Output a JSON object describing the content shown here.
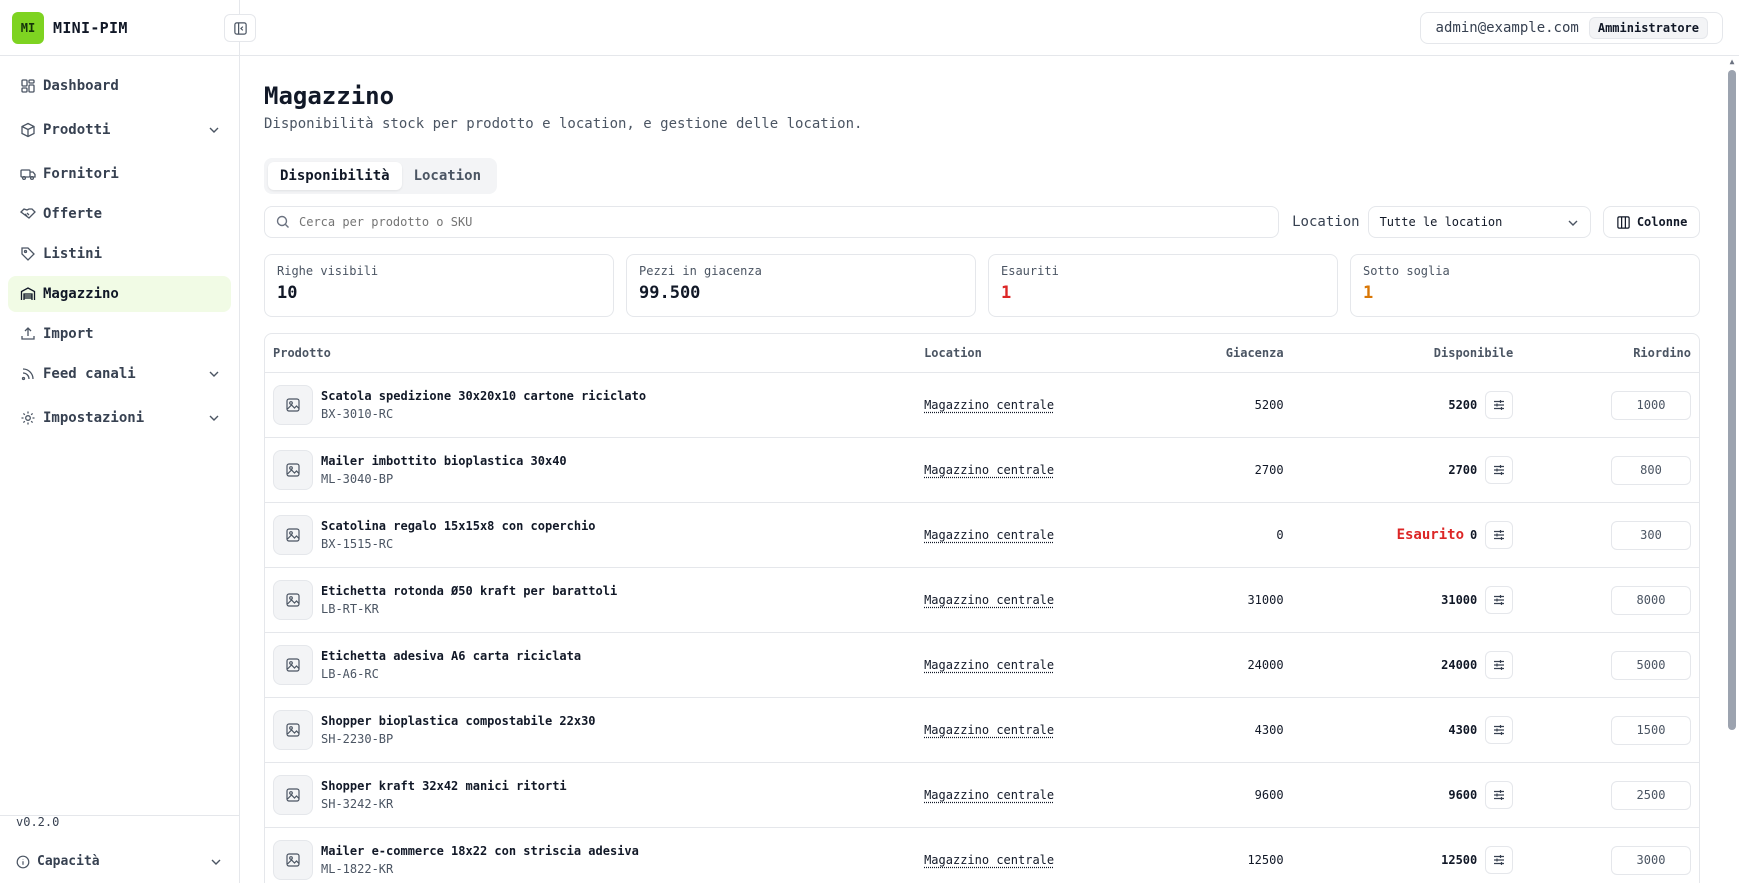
{
  "app": {
    "logo_text": "MI",
    "name": "MINI-PIM",
    "version": "v0.2.0",
    "accent": "#7ed321"
  },
  "sidebar": {
    "items": [
      {
        "label": "Dashboard",
        "icon": "dashboard-icon"
      },
      {
        "label": "Prodotti",
        "icon": "package-icon",
        "expandable": true
      },
      {
        "label": "Fornitori",
        "icon": "truck-icon"
      },
      {
        "label": "Offerte",
        "icon": "handshake-icon"
      },
      {
        "label": "Listini",
        "icon": "tag-icon"
      },
      {
        "label": "Magazzino",
        "icon": "warehouse-icon",
        "active": true
      },
      {
        "label": "Import",
        "icon": "upload-icon"
      },
      {
        "label": "Feed canali",
        "icon": "rss-icon",
        "expandable": true
      },
      {
        "label": "Impostazioni",
        "icon": "gear-icon",
        "expandable": true
      }
    ],
    "footer": {
      "capacity_label": "Capacità"
    }
  },
  "header": {
    "user_email": "admin@example.com",
    "role": "Amministratore"
  },
  "page": {
    "title": "Magazzino",
    "subtitle": "Disponibilità stock per prodotto e location, e gestione delle location.",
    "tabs": [
      {
        "label": "Disponibilità",
        "active": true
      },
      {
        "label": "Location",
        "active": false
      }
    ]
  },
  "filters": {
    "search_placeholder": "Cerca per prodotto o SKU",
    "location_label": "Location",
    "location_value": "Tutte le location",
    "columns_label": "Colonne"
  },
  "stats": [
    {
      "label": "Righe visibili",
      "value": "10"
    },
    {
      "label": "Pezzi in giacenza",
      "value": "99.500"
    },
    {
      "label": "Esauriti",
      "value": "1"
    },
    {
      "label": "Sotto soglia",
      "value": "1"
    }
  ],
  "table": {
    "headers": {
      "product": "Prodotto",
      "location": "Location",
      "stock": "Giacenza",
      "available": "Disponibile",
      "reorder": "Riordino"
    },
    "out_of_stock_label": "Esaurito",
    "rows": [
      {
        "name": "Scatola spedizione 30x20x10 cartone riciclato",
        "sku": "BX-3010-RC",
        "location": "Magazzino centrale",
        "stock": "5200",
        "available": "5200",
        "reorder": "1000",
        "out": false
      },
      {
        "name": "Mailer imbottito bioplastica 30x40",
        "sku": "ML-3040-BP",
        "location": "Magazzino centrale",
        "stock": "2700",
        "available": "2700",
        "reorder": "800",
        "out": false
      },
      {
        "name": "Scatolina regalo 15x15x8 con coperchio",
        "sku": "BX-1515-RC",
        "location": "Magazzino centrale",
        "stock": "0",
        "available": "0",
        "reorder": "300",
        "out": true
      },
      {
        "name": "Etichetta rotonda Ø50 kraft per barattoli",
        "sku": "LB-RT-KR",
        "location": "Magazzino centrale",
        "stock": "31000",
        "available": "31000",
        "reorder": "8000",
        "out": false
      },
      {
        "name": "Etichetta adesiva A6 carta riciclata",
        "sku": "LB-A6-RC",
        "location": "Magazzino centrale",
        "stock": "24000",
        "available": "24000",
        "reorder": "5000",
        "out": false
      },
      {
        "name": "Shopper bioplastica compostabile 22x30",
        "sku": "SH-2230-BP",
        "location": "Magazzino centrale",
        "stock": "4300",
        "available": "4300",
        "reorder": "1500",
        "out": false
      },
      {
        "name": "Shopper kraft 32x42 manici ritorti",
        "sku": "SH-3242-KR",
        "location": "Magazzino centrale",
        "stock": "9600",
        "available": "9600",
        "reorder": "2500",
        "out": false
      },
      {
        "name": "Mailer e-commerce 18x22 con striscia adesiva",
        "sku": "ML-1822-KR",
        "location": "Magazzino centrale",
        "stock": "12500",
        "available": "12500",
        "reorder": "3000",
        "out": false
      }
    ]
  },
  "colors": {
    "danger": "#dc2626",
    "warning": "#d97706",
    "active_nav_bg": "#f1fbe5"
  }
}
